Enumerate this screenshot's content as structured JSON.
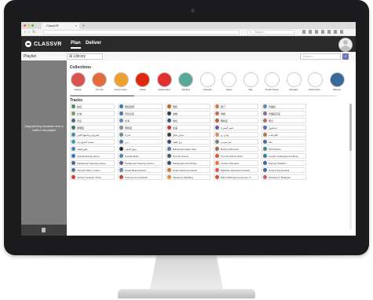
{
  "browser": {
    "tab_title": "ClassVR",
    "tab_close": "×",
    "new_tab": "+",
    "nav_arrows": "‹ › ↻",
    "search_placeholder": "Search",
    "window_controls": [
      "#ff5f57",
      "#ffbd2e",
      "#28c940"
    ]
  },
  "app": {
    "brand": "CLASSVR",
    "nav": [
      {
        "label": "Plan",
        "active": true
      },
      {
        "label": "Deliver",
        "active": false
      }
    ]
  },
  "toolbar": {
    "playlist_label": "Playlist",
    "library_label": "⊞ Library",
    "search_placeholder": "Search...",
    "search_button": "⌕"
  },
  "sidebar": {
    "message": "Drag and drop resources here to make a new playlist",
    "trash_icon": "trash-icon"
  },
  "collections": {
    "heading": "Collections",
    "items": [
      {
        "label": "Global",
        "color": "#d9534f"
      },
      {
        "label": "UK Life",
        "color": "#e36b3c"
      },
      {
        "label": "Ancient Dev.",
        "color": "#f0a030"
      },
      {
        "label": "China",
        "color": "#de2910"
      },
      {
        "label": "Switzerland",
        "color": "#e03030"
      },
      {
        "label": "Zambia",
        "color": "#5aa89a"
      },
      {
        "label": "Canada",
        "color": "#ffffff"
      },
      {
        "label": "Japan",
        "color": "#ffffff"
      },
      {
        "label": "Italy",
        "color": "#ffffff"
      },
      {
        "label": "South Korea",
        "color": "#ffffff"
      },
      {
        "label": "Hungary",
        "color": "#ffffff"
      },
      {
        "label": "Czech Rep...",
        "color": "#ffffff"
      },
      {
        "label": "Planets",
        "color": "#3a6a9a"
      }
    ]
  },
  "tracks": {
    "heading": "Tracks",
    "rows": [
      [
        {
          "label": "故宫",
          "color": "#4a8a6a"
        },
        {
          "label": "颐和园南",
          "color": "#3a7aa0"
        },
        {
          "label": "颐和",
          "color": "#c06030"
        },
        {
          "label": "前门",
          "color": "#d08040"
        },
        {
          "label": "景福宫",
          "color": "#5a8ab0"
        }
      ],
      [
        {
          "label": "长城",
          "color": "#7a9a6a"
        },
        {
          "label": "天坛北区",
          "color": "#4a7aa0"
        },
        {
          "label": "鼓楼",
          "color": "#3a3a3a"
        },
        {
          "label": "钟楼",
          "color": "#c07050"
        },
        {
          "label": "景福宫东区",
          "color": "#8a6aa0"
        }
      ],
      [
        {
          "label": "天坛",
          "color": "#4a6a8a"
        },
        {
          "label": "北海",
          "color": "#6a8ab0"
        },
        {
          "label": "地坛",
          "color": "#3a5a7a"
        },
        {
          "label": "雍和宫",
          "color": "#b06040"
        },
        {
          "label": "南汉",
          "color": "#c06a5a"
        }
      ],
      [
        {
          "label": "圆明园",
          "color": "#3a7a5a"
        },
        {
          "label": "颐和园",
          "color": "#8a8a8a"
        },
        {
          "label": "太庙",
          "color": "#c03a3a"
        },
        {
          "label": "قصر الحمراء",
          "color": "#6a5a9a"
        },
        {
          "label": "استانبول",
          "color": "#5a6ab0"
        }
      ],
      [
        {
          "label": "القيروان وجامعها الكبير",
          "color": "#4a8ab0"
        },
        {
          "label": "البتراء",
          "color": "#6a8a9a"
        },
        {
          "label": "مدائن صالح",
          "color": "#3a3a3a"
        },
        {
          "label": "وادي رم",
          "color": "#d0905a"
        },
        {
          "label": "الأهرامات",
          "color": "#c0704a"
        }
      ],
      [
        {
          "label": "مسجد الشيخ زايد",
          "color": "#3a9ab0"
        },
        {
          "label": "دبي",
          "color": "#4a7aa0"
        },
        {
          "label": "برج خليفة",
          "color": "#3a4a6a"
        },
        {
          "label": "جبل موسى",
          "color": "#6a8a6a"
        },
        {
          "label": "مكة",
          "color": "#4a6ab0"
        }
      ],
      [
        {
          "label": "خليج العقبة",
          "color": "#3a8ab0"
        },
        {
          "label": "سوق الذهب",
          "color": "#2a2a2a"
        },
        {
          "label": "Edinburgh Castle View",
          "color": "#5a7a9a"
        },
        {
          "label": "Buxton's Bunnies",
          "color": "#9a6a4a"
        },
        {
          "label": "Sfb Flowers",
          "color": "#4a8a7a"
        }
      ],
      [
        {
          "label": "Snowboarding Scene",
          "color": "#3a7ab0"
        },
        {
          "label": "Snowboarder",
          "color": "#4a8ab0"
        },
        {
          "label": "Tour de France",
          "color": "#3a5a7a"
        },
        {
          "label": "Tour de France 2013",
          "color": "#d05a3a"
        },
        {
          "label": "London Underground Library",
          "color": "#3a7aa0"
        }
      ],
      [
        {
          "label": "Paralympic Opening Cerem...",
          "color": "#4a6a8a"
        },
        {
          "label": "Paralympic Opening Cerem...",
          "color": "#6a5a8a"
        },
        {
          "label": "Paralympic Ice Hockey",
          "color": "#3a4a6a"
        },
        {
          "label": "London Olympics",
          "color": "#e07a3a"
        },
        {
          "label": "Olympic Stadium",
          "color": "#3a6a9a"
        }
      ],
      [
        {
          "label": "Olympic Park, London",
          "color": "#4a7a9a"
        },
        {
          "label": "Diwali Mela Festival",
          "color": "#5a8ab0"
        },
        {
          "label": "Hindu Dancing Festival",
          "color": "#d07a3a"
        },
        {
          "label": "Parkside Japanese Festival",
          "color": "#e05a4a"
        },
        {
          "label": "Hong Kong Festival",
          "color": "#3a6a9a"
        }
      ],
      [
        {
          "label": "Lantern Festival, China",
          "color": "#d03a3a"
        },
        {
          "label": "Chinese Lion Festival",
          "color": "#c04a3a"
        },
        {
          "label": "Japanese Wedding",
          "color": "#e08a3a"
        },
        {
          "label": "Maori Marriage Ceremony, S...",
          "color": "#c05a3a"
        },
        {
          "label": "Wedding in Malaysia",
          "color": "#d05a6a"
        }
      ]
    ]
  }
}
